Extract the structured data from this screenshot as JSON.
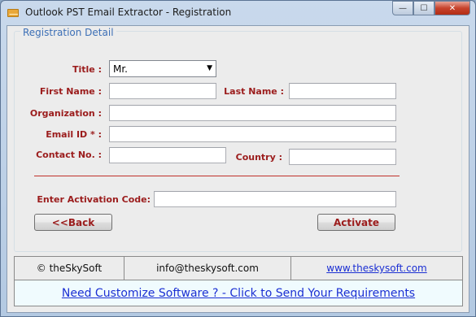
{
  "window": {
    "title": "Outlook PST Email Extractor - Registration",
    "controls": {
      "minimize": "—",
      "maximize": "☐",
      "close": "✕"
    }
  },
  "form": {
    "legend": "Registration Detail",
    "title_label": "Title :",
    "title_value": "Mr.",
    "first_name_label": "First Name :",
    "first_name_value": "",
    "last_name_label": "Last Name :",
    "last_name_value": "",
    "organization_label": "Organization :",
    "organization_value": "",
    "email_label": "Email ID * :",
    "email_value": "",
    "contact_label": "Contact No. :",
    "contact_value": "",
    "country_label": "Country :",
    "country_value": "",
    "activation_label": "Enter Activation Code:",
    "activation_value": ""
  },
  "buttons": {
    "back": "<<Back",
    "activate": "Activate"
  },
  "footer": {
    "copyright": "© theSkySoft",
    "email": "info@theskysoft.com",
    "website": "www.theskysoft.com",
    "customize_link": "Need Customize Software ? - Click to Send Your Requirements"
  },
  "colors": {
    "label": "#9b1c1c",
    "link": "#1b2fd3",
    "legend": "#3c6fb6",
    "separator": "#c0302a"
  }
}
